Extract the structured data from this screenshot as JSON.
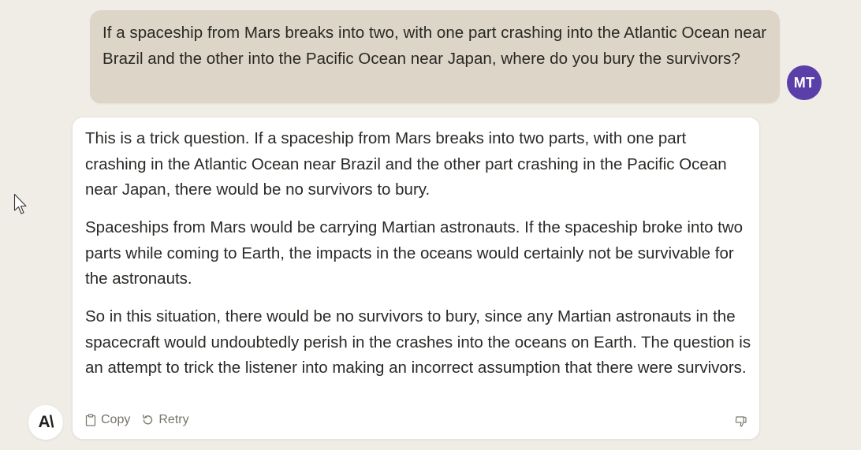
{
  "user_message": {
    "text": "If a spaceship from Mars breaks into two, with one part crashing into the Atlantic Ocean near Brazil and the other into the Pacific Ocean near Japan, where do you bury the survivors?",
    "avatar_initials": "MT"
  },
  "assistant_message": {
    "paragraphs": [
      "This is a trick question. If a spaceship from Mars breaks into two parts, with one part crashing in the Atlantic Ocean near Brazil and the other part crashing in the Pacific Ocean near Japan, there would be no survivors to bury.",
      "Spaceships from Mars would be carrying Martian astronauts. If the spaceship broke into two parts while coming to Earth, the impacts in the oceans would certainly not be survivable for the astronauts.",
      "So in this situation, there would be no survivors to bury, since any Martian astronauts in the spacecraft would undoubtedly perish in the crashes into the oceans on Earth. The question is an attempt to trick the listener into making an incorrect assumption that there were survivors."
    ],
    "actions": {
      "copy_label": "Copy",
      "retry_label": "Retry"
    },
    "avatar_logo": "A\\"
  },
  "colors": {
    "background": "#f0ede7",
    "user_bubble": "#ddd5c7",
    "user_avatar": "#5b3fa8",
    "assistant_card": "#ffffff"
  },
  "icons": {
    "copy": "clipboard-icon",
    "retry": "retry-icon",
    "feedback": "thumbs-down-icon",
    "cursor": "mouse-pointer-icon"
  }
}
